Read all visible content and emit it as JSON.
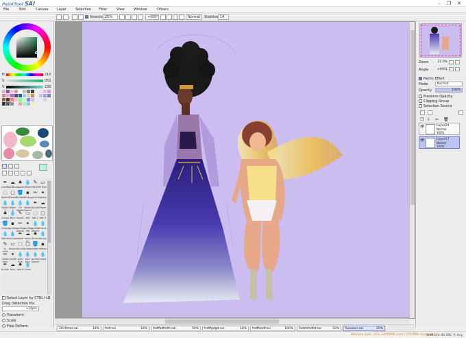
{
  "titlebar": {
    "logo_small": "PaintTool",
    "logo_big": "SAI",
    "minimize": "–",
    "maximize": "❐",
    "close": "✕"
  },
  "menu": [
    "File",
    "Edit",
    "Canvas",
    "Layer",
    "Selection",
    "Filter",
    "View",
    "Window",
    "Others"
  ],
  "toolbar": {
    "selection_label": "Selection",
    "zoom": "25%",
    "rotation": "+000°",
    "blend_mode": "Normal",
    "stabilizer_label": "Stabilizer",
    "stabilizer_value": "14"
  },
  "color": {
    "h_label": "H",
    "h_value": "210",
    "s_label": "S",
    "s_value": "052",
    "v_label": "V",
    "v_value": "230",
    "swatches": [
      "#c8b4d6",
      "#8a5aa0",
      "#e8c8d8",
      "#d4a0b0",
      "#ffffff",
      "#c0c0c0",
      "#808080",
      "#404040",
      "#d08090",
      "#e0b0c0",
      "#a070c0",
      "#604080",
      "#2060a0",
      "#a0c8e8",
      "#f0d0a0",
      "#c09070",
      "#8a6040",
      "#503020",
      "#ff8080",
      "#ffc0c0",
      "#80ff80",
      "#c0ffc0",
      "#8080ff",
      "#c0c0ff",
      "#303030",
      "#606060",
      "#909090",
      "#e8e8e8",
      "#f0a0c0",
      "#a0f0c0",
      "#a0c0f0",
      "#f0f0a0"
    ]
  },
  "tools": {
    "brushes": [
      "LineBrush",
      "AirBrush",
      "spade",
      "Water",
      "",
      "Marker",
      "Eraser",
      "Select",
      "Deselect",
      "",
      "Bucket",
      "Binary",
      "pencil",
      "spread",
      "",
      "Water 2",
      "Water 3",
      "Oil Water",
      "Water Blend",
      "",
      "Acrylic",
      "Paper",
      "Crayon",
      "Blur",
      "",
      "brush",
      "felt",
      "felt 2",
      "felt 3",
      "",
      "crayon",
      "gurikaa",
      "gurikaa shading",
      "gurikaa flat",
      "gurikaa shading",
      "fresco",
      "Marker",
      "Acrylic",
      "",
      "sketch",
      "even lin",
      "Brush",
      "Acrylic",
      "",
      "b-cold",
      "texture",
      "Acrylic",
      "bristle",
      "",
      "sketc",
      "eReaser",
      "clean pen",
      "LineBrush",
      "",
      "pink line",
      "blur blur",
      "gurikaa shading",
      "snow",
      "",
      "brushes",
      "blur",
      "paint",
      "Lines",
      ""
    ],
    "select_layer_label": "Select Layer by CTRL+LB",
    "drag_detection_label": "Drag Detection Pix.",
    "drag_detection_value": "+16pix",
    "transform_label": "Transform",
    "scale_label": "Scale",
    "free_deform_label": "Free Deform"
  },
  "navigator": {
    "zoom_label": "Zoom",
    "zoom_value": "25.0%",
    "angle_label": "Angle",
    "angle_value": "+000$"
  },
  "layer_props": {
    "effect_label": "Paints Effect",
    "mode_label": "Mode",
    "mode_value": "Normal",
    "opacity_label": "Opacity",
    "opacity_value": "100%",
    "preserve_opacity": "Preserve Opacity",
    "clipping_group": "Clipping Group",
    "selection_source": "Selection Source"
  },
  "layers": [
    {
      "name": "Layer24",
      "mode": "Normal",
      "opacity": "100%",
      "selected": false
    },
    {
      "name": "Layer17",
      "mode": "Normal",
      "opacity": "100%",
      "selected": true
    }
  ],
  "tabs": [
    {
      "name": "2019mar.sai",
      "pct": "18%",
      "active": false
    },
    {
      "name": "fsdf.sai",
      "pct": "18%",
      "active": false
    },
    {
      "name": "fsdffsdfsdfs.sai",
      "pct": "50%",
      "active": false
    },
    {
      "name": "fsdffgdgd.sai",
      "pct": "18%",
      "active": false
    },
    {
      "name": "fsdffsadf.sai",
      "pct": "100%",
      "active": false
    },
    {
      "name": "fsdsfsfsdfsf.sai",
      "pct": "33%",
      "active": false
    },
    {
      "name": "flusooon.sai",
      "pct": "25%",
      "active": true
    }
  ],
  "status": {
    "memory": "Memory load: 24% (1626MB used / 2719MB reserved)",
    "keys": "Shift Ctrl Alt SPC ⓦ Any"
  },
  "accent_color": "#cbbdf0"
}
